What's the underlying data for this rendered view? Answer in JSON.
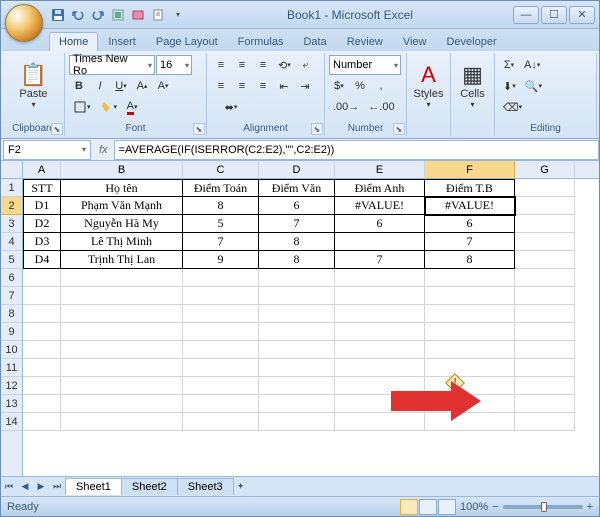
{
  "title": "Book1 - Microsoft Excel",
  "tabs": [
    "Home",
    "Insert",
    "Page Layout",
    "Formulas",
    "Data",
    "Review",
    "View",
    "Developer"
  ],
  "activeTab": 0,
  "groups": {
    "clipboard": "Clipboard",
    "font": "Font",
    "alignment": "Alignment",
    "number": "Number",
    "styles": "Styles",
    "cells": "Cells",
    "editing": "Editing"
  },
  "font": {
    "name": "Times New Ro",
    "size": "16"
  },
  "numberFormat": "Number",
  "paste": "Paste",
  "stylesBtn": "Styles",
  "cellsBtn": "Cells",
  "nameBox": "F2",
  "formula": "=AVERAGE(IF(ISERROR(C2:E2),\"\",C2:E2))",
  "colW": {
    "A": 38,
    "B": 122,
    "C": 76,
    "D": 76,
    "E": 90,
    "F": 90,
    "G": 60
  },
  "colHeaders": [
    "A",
    "B",
    "C",
    "D",
    "E",
    "F",
    "G"
  ],
  "rowCount": 14,
  "selectedCell": "F2",
  "table": {
    "headers": [
      "STT",
      "Họ tên",
      "Điểm Toán",
      "Điểm Văn",
      "Điểm Anh",
      "Điểm T.B"
    ],
    "rows": [
      [
        "D1",
        "Phạm Văn Mạnh",
        "8",
        "6",
        "#VALUE!",
        "#VALUE!"
      ],
      [
        "D2",
        "Nguyễn Hà My",
        "5",
        "7",
        "6",
        "6"
      ],
      [
        "D3",
        "Lê Thị Minh",
        "7",
        "8",
        "",
        "7"
      ],
      [
        "D4",
        "Trịnh Thị Lan",
        "9",
        "8",
        "7",
        "8"
      ]
    ]
  },
  "sheets": [
    "Sheet1",
    "Sheet2",
    "Sheet3"
  ],
  "activeSheet": 0,
  "status": "Ready",
  "zoom": "100%"
}
